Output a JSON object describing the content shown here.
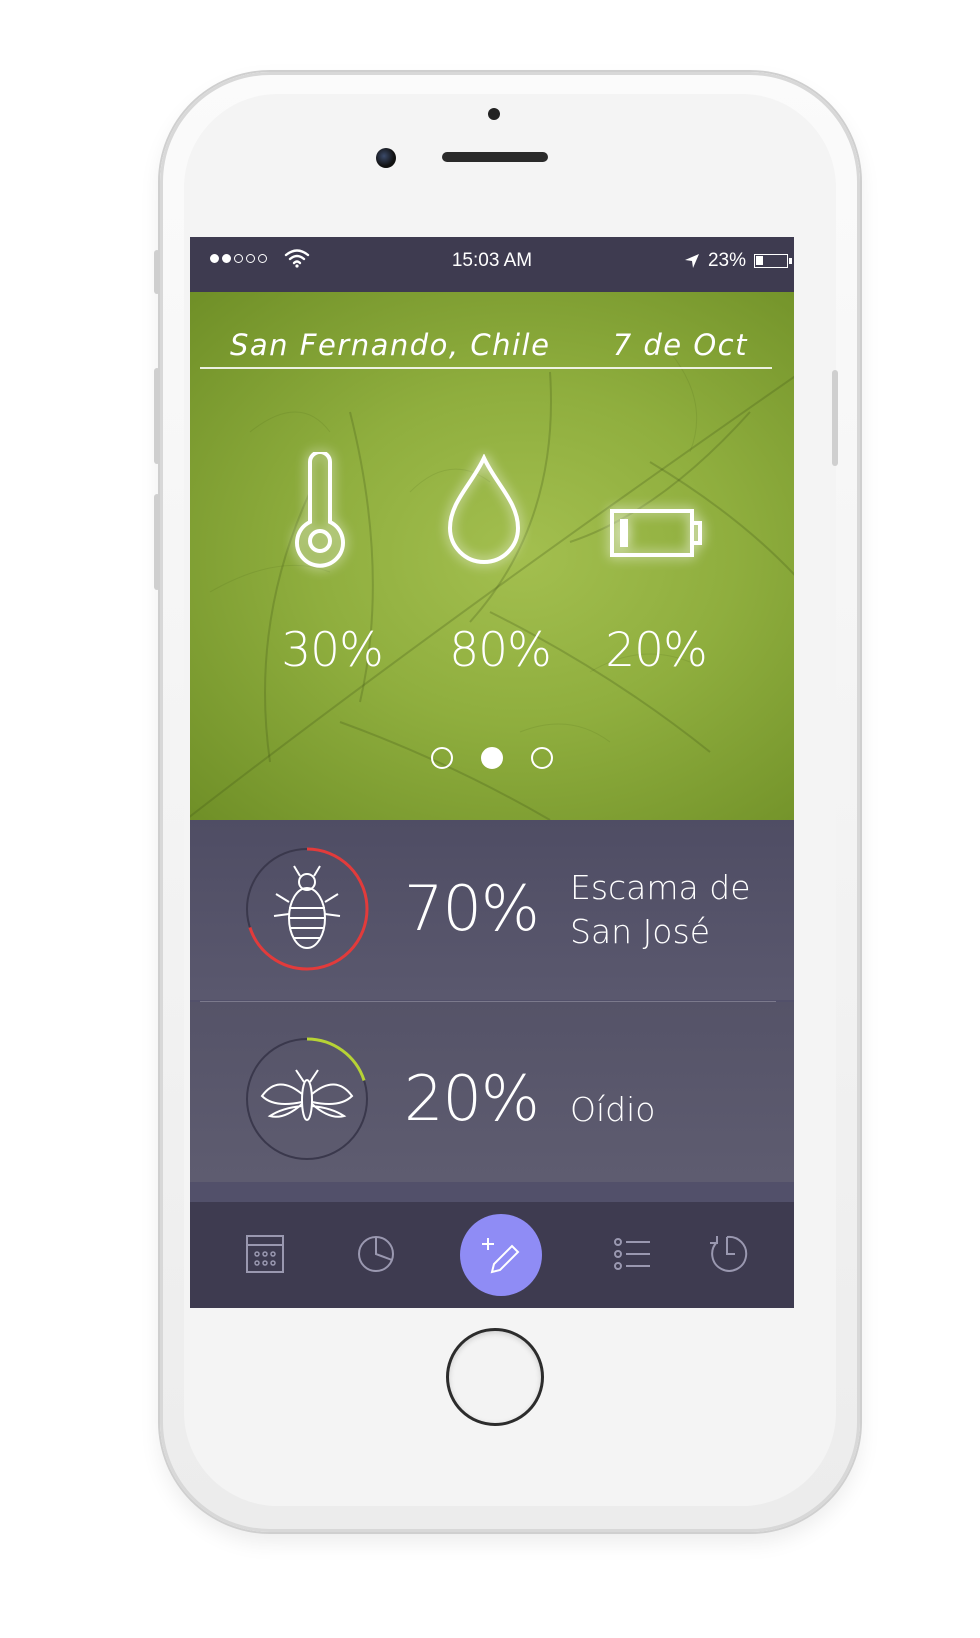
{
  "status_bar": {
    "signal_bars_filled": 2,
    "signal_bars_total": 5,
    "time": "15:03 AM",
    "battery_percent_label": "23%",
    "battery_level": 0.23
  },
  "header": {
    "location": "San Fernando, Chile",
    "date": "7 de Oct"
  },
  "metrics": [
    {
      "icon": "thermometer-icon",
      "value": "30%"
    },
    {
      "icon": "water-drop-icon",
      "value": "80%"
    },
    {
      "icon": "battery-icon",
      "value": "20%"
    }
  ],
  "pager": {
    "pages": 3,
    "active_index": 1
  },
  "pests": [
    {
      "icon": "scale-insect-icon",
      "percent": "70%",
      "name": "Escama de San José",
      "ring_fraction": 0.7,
      "ring_color": "#e23b3b"
    },
    {
      "icon": "moth-icon",
      "percent": "20%",
      "name": "Oídio",
      "ring_fraction": 0.2,
      "ring_color": "#b7d335"
    }
  ],
  "tabbar": {
    "tabs": [
      "calendar-icon",
      "pie-chart-icon",
      "add-edit-icon",
      "list-icon",
      "history-icon"
    ],
    "accent": "#8f8cf5"
  },
  "colors": {
    "status_bar_bg": "#3e3b50",
    "leaf_green": "#8fae3e",
    "list_bg": "#52506a"
  }
}
